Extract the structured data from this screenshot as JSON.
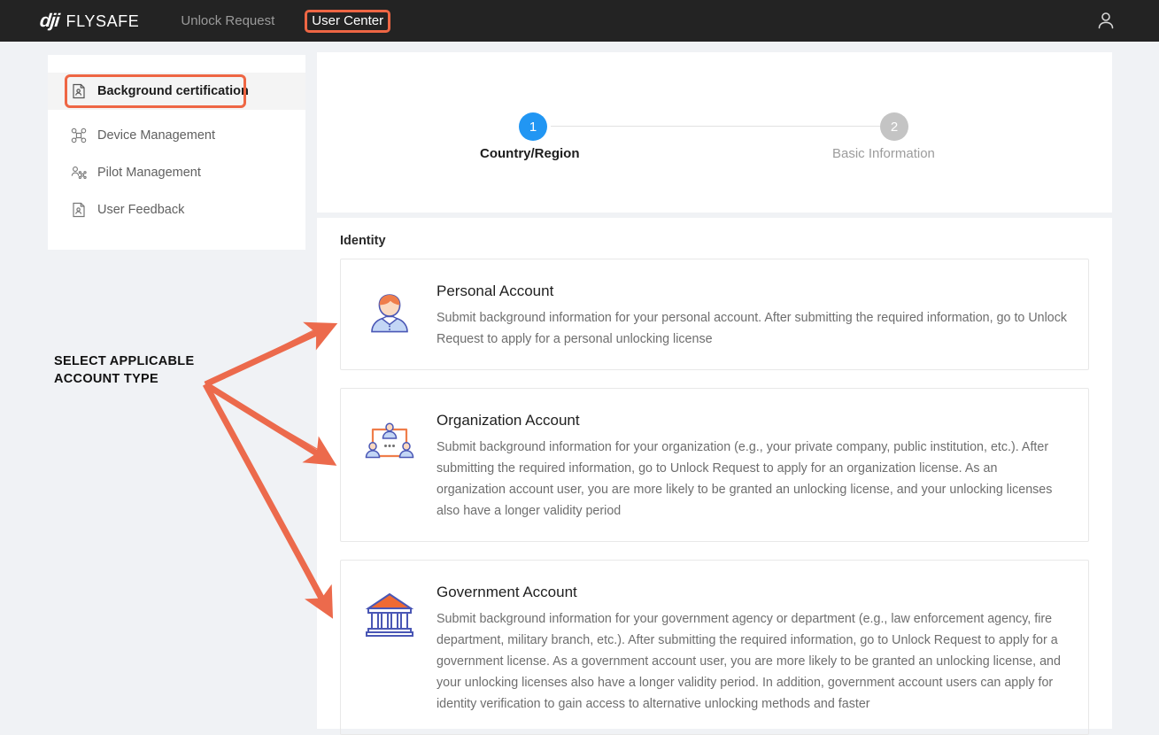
{
  "header": {
    "brand_dji": "dji",
    "brand_word": "FLYSAFE",
    "nav": [
      {
        "label": "Unlock Request",
        "active": false,
        "highlighted": false
      },
      {
        "label": "User Center",
        "active": true,
        "highlighted": true
      }
    ],
    "account_icon": "user-avatar-icon",
    "background_color": "#232323",
    "highlight_color": "#ee6644"
  },
  "sidebar": {
    "items": [
      {
        "label": "Background certification",
        "icon": "document-person-icon",
        "active": true,
        "highlighted": true
      },
      {
        "label": "Device Management",
        "icon": "drone-icon",
        "active": false,
        "highlighted": false
      },
      {
        "label": "Pilot Management",
        "icon": "pilot-icon",
        "active": false,
        "highlighted": false
      },
      {
        "label": "User Feedback",
        "icon": "document-person-icon",
        "active": false,
        "highlighted": false
      }
    ]
  },
  "stepper": {
    "steps": [
      {
        "number": "1",
        "label": "Country/Region",
        "state": "active",
        "color": "#2196f3"
      },
      {
        "number": "2",
        "label": "Basic Information",
        "state": "inactive",
        "color": "#c4c4c4"
      }
    ]
  },
  "identity": {
    "section_title": "Identity",
    "accounts": [
      {
        "title": "Personal Account",
        "icon": "personal-account-icon",
        "description": "Submit background information for your personal account. After submitting the required information, go to Unlock Request to apply for a personal unlocking license"
      },
      {
        "title": "Organization Account",
        "icon": "organization-account-icon",
        "description": "Submit background information for your organization (e.g., your private company, public institution, etc.). After submitting the required information, go to Unlock Request to apply for an organization license. As an organization account user, you are more likely to be granted an unlocking license, and your unlocking licenses also have a longer validity period"
      },
      {
        "title": "Government Account",
        "icon": "government-account-icon",
        "description": "Submit background information for your government agency or department (e.g., law enforcement agency, fire department, military branch, etc.). After submitting the required information, go to Unlock Request to apply for a government license. As a government account user, you are more likely to be granted an unlocking license, and your unlocking licenses also have a longer validity period. In addition, government account users can apply for identity verification to gain access to alternative unlocking methods and faster"
      }
    ]
  },
  "annotation": {
    "callout_text": "SELECT APPLICABLE ACCOUNT TYPE",
    "arrow_color": "#ec6a4c",
    "arrow_count": 3
  }
}
